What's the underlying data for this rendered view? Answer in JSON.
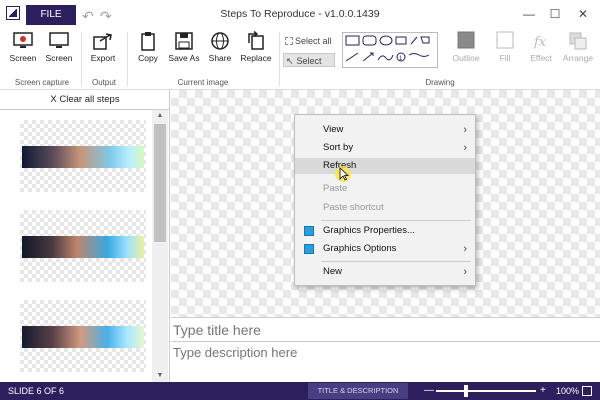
{
  "window": {
    "title": "Steps To Reproduce - v1.0.0.1439",
    "minimize": "—",
    "maximize": "☐",
    "close": "✕"
  },
  "file_tab": "FILE",
  "ribbon": {
    "screen_capture": {
      "buttons": [
        "Screen",
        "Screen"
      ],
      "group": "Screen capture"
    },
    "output": {
      "export": "Export",
      "group": "Output"
    },
    "current_image": {
      "copy": "Copy",
      "save_as": "Save As",
      "share": "Share",
      "replace": "Replace",
      "group": "Current image"
    },
    "select_all": "Select all",
    "select": "Select",
    "drawing": {
      "outline": "Outline",
      "fill": "Fill",
      "effect": "Effect",
      "arrange": "Arrange",
      "group": "Drawing"
    }
  },
  "sidebar": {
    "clear_all": "X Clear all steps"
  },
  "context_menu": {
    "items": [
      {
        "label": "View",
        "submenu": true,
        "state": "normal"
      },
      {
        "label": "Sort by",
        "submenu": true,
        "state": "normal"
      },
      {
        "label": "Refresh",
        "submenu": false,
        "state": "hover"
      },
      {
        "label": "Paste",
        "submenu": false,
        "state": "disabled"
      },
      {
        "label": "Paste shortcut",
        "submenu": false,
        "state": "disabled"
      },
      {
        "label": "Graphics Properties...",
        "submenu": false,
        "state": "normal",
        "icon": "intel-graphics-icon"
      },
      {
        "label": "Graphics Options",
        "submenu": true,
        "state": "normal",
        "icon": "intel-graphics-icon"
      },
      {
        "label": "New",
        "submenu": true,
        "state": "normal"
      }
    ]
  },
  "title_placeholder": "Type title here",
  "description_placeholder": "Type description here",
  "status": {
    "slide": "SLIDE 6 OF 6",
    "title_desc": "TITLE & DESCRIPTION",
    "zoom": "100%",
    "zoom_fraction": 0.3
  },
  "colors": {
    "accent": "#2b1f5e",
    "menu_bg": "#f2f2f2",
    "hover": "#dadada",
    "cursor_highlight": "#ffe63c"
  }
}
